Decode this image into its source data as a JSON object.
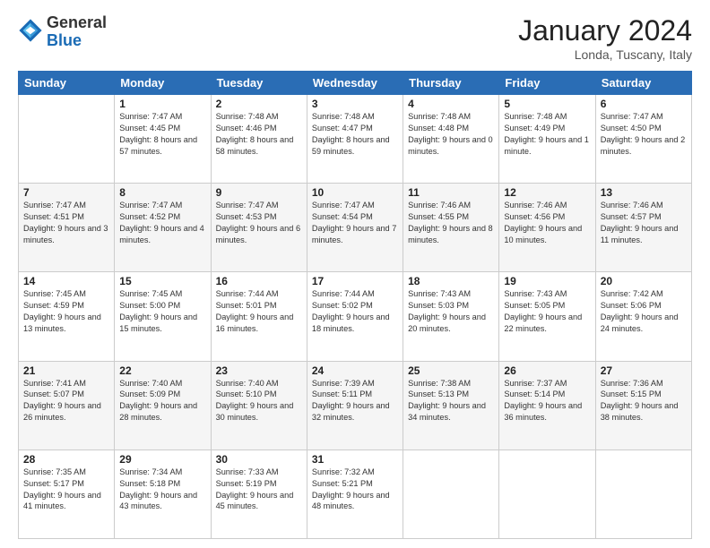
{
  "header": {
    "logo_general": "General",
    "logo_blue": "Blue",
    "month_title": "January 2024",
    "location": "Londa, Tuscany, Italy"
  },
  "days_of_week": [
    "Sunday",
    "Monday",
    "Tuesday",
    "Wednesday",
    "Thursday",
    "Friday",
    "Saturday"
  ],
  "weeks": [
    [
      {
        "day": "",
        "sunrise": "",
        "sunset": "",
        "daylight": ""
      },
      {
        "day": "1",
        "sunrise": "Sunrise: 7:47 AM",
        "sunset": "Sunset: 4:45 PM",
        "daylight": "Daylight: 8 hours and 57 minutes."
      },
      {
        "day": "2",
        "sunrise": "Sunrise: 7:48 AM",
        "sunset": "Sunset: 4:46 PM",
        "daylight": "Daylight: 8 hours and 58 minutes."
      },
      {
        "day": "3",
        "sunrise": "Sunrise: 7:48 AM",
        "sunset": "Sunset: 4:47 PM",
        "daylight": "Daylight: 8 hours and 59 minutes."
      },
      {
        "day": "4",
        "sunrise": "Sunrise: 7:48 AM",
        "sunset": "Sunset: 4:48 PM",
        "daylight": "Daylight: 9 hours and 0 minutes."
      },
      {
        "day": "5",
        "sunrise": "Sunrise: 7:48 AM",
        "sunset": "Sunset: 4:49 PM",
        "daylight": "Daylight: 9 hours and 1 minute."
      },
      {
        "day": "6",
        "sunrise": "Sunrise: 7:47 AM",
        "sunset": "Sunset: 4:50 PM",
        "daylight": "Daylight: 9 hours and 2 minutes."
      }
    ],
    [
      {
        "day": "7",
        "sunrise": "Sunrise: 7:47 AM",
        "sunset": "Sunset: 4:51 PM",
        "daylight": "Daylight: 9 hours and 3 minutes."
      },
      {
        "day": "8",
        "sunrise": "Sunrise: 7:47 AM",
        "sunset": "Sunset: 4:52 PM",
        "daylight": "Daylight: 9 hours and 4 minutes."
      },
      {
        "day": "9",
        "sunrise": "Sunrise: 7:47 AM",
        "sunset": "Sunset: 4:53 PM",
        "daylight": "Daylight: 9 hours and 6 minutes."
      },
      {
        "day": "10",
        "sunrise": "Sunrise: 7:47 AM",
        "sunset": "Sunset: 4:54 PM",
        "daylight": "Daylight: 9 hours and 7 minutes."
      },
      {
        "day": "11",
        "sunrise": "Sunrise: 7:46 AM",
        "sunset": "Sunset: 4:55 PM",
        "daylight": "Daylight: 9 hours and 8 minutes."
      },
      {
        "day": "12",
        "sunrise": "Sunrise: 7:46 AM",
        "sunset": "Sunset: 4:56 PM",
        "daylight": "Daylight: 9 hours and 10 minutes."
      },
      {
        "day": "13",
        "sunrise": "Sunrise: 7:46 AM",
        "sunset": "Sunset: 4:57 PM",
        "daylight": "Daylight: 9 hours and 11 minutes."
      }
    ],
    [
      {
        "day": "14",
        "sunrise": "Sunrise: 7:45 AM",
        "sunset": "Sunset: 4:59 PM",
        "daylight": "Daylight: 9 hours and 13 minutes."
      },
      {
        "day": "15",
        "sunrise": "Sunrise: 7:45 AM",
        "sunset": "Sunset: 5:00 PM",
        "daylight": "Daylight: 9 hours and 15 minutes."
      },
      {
        "day": "16",
        "sunrise": "Sunrise: 7:44 AM",
        "sunset": "Sunset: 5:01 PM",
        "daylight": "Daylight: 9 hours and 16 minutes."
      },
      {
        "day": "17",
        "sunrise": "Sunrise: 7:44 AM",
        "sunset": "Sunset: 5:02 PM",
        "daylight": "Daylight: 9 hours and 18 minutes."
      },
      {
        "day": "18",
        "sunrise": "Sunrise: 7:43 AM",
        "sunset": "Sunset: 5:03 PM",
        "daylight": "Daylight: 9 hours and 20 minutes."
      },
      {
        "day": "19",
        "sunrise": "Sunrise: 7:43 AM",
        "sunset": "Sunset: 5:05 PM",
        "daylight": "Daylight: 9 hours and 22 minutes."
      },
      {
        "day": "20",
        "sunrise": "Sunrise: 7:42 AM",
        "sunset": "Sunset: 5:06 PM",
        "daylight": "Daylight: 9 hours and 24 minutes."
      }
    ],
    [
      {
        "day": "21",
        "sunrise": "Sunrise: 7:41 AM",
        "sunset": "Sunset: 5:07 PM",
        "daylight": "Daylight: 9 hours and 26 minutes."
      },
      {
        "day": "22",
        "sunrise": "Sunrise: 7:40 AM",
        "sunset": "Sunset: 5:09 PM",
        "daylight": "Daylight: 9 hours and 28 minutes."
      },
      {
        "day": "23",
        "sunrise": "Sunrise: 7:40 AM",
        "sunset": "Sunset: 5:10 PM",
        "daylight": "Daylight: 9 hours and 30 minutes."
      },
      {
        "day": "24",
        "sunrise": "Sunrise: 7:39 AM",
        "sunset": "Sunset: 5:11 PM",
        "daylight": "Daylight: 9 hours and 32 minutes."
      },
      {
        "day": "25",
        "sunrise": "Sunrise: 7:38 AM",
        "sunset": "Sunset: 5:13 PM",
        "daylight": "Daylight: 9 hours and 34 minutes."
      },
      {
        "day": "26",
        "sunrise": "Sunrise: 7:37 AM",
        "sunset": "Sunset: 5:14 PM",
        "daylight": "Daylight: 9 hours and 36 minutes."
      },
      {
        "day": "27",
        "sunrise": "Sunrise: 7:36 AM",
        "sunset": "Sunset: 5:15 PM",
        "daylight": "Daylight: 9 hours and 38 minutes."
      }
    ],
    [
      {
        "day": "28",
        "sunrise": "Sunrise: 7:35 AM",
        "sunset": "Sunset: 5:17 PM",
        "daylight": "Daylight: 9 hours and 41 minutes."
      },
      {
        "day": "29",
        "sunrise": "Sunrise: 7:34 AM",
        "sunset": "Sunset: 5:18 PM",
        "daylight": "Daylight: 9 hours and 43 minutes."
      },
      {
        "day": "30",
        "sunrise": "Sunrise: 7:33 AM",
        "sunset": "Sunset: 5:19 PM",
        "daylight": "Daylight: 9 hours and 45 minutes."
      },
      {
        "day": "31",
        "sunrise": "Sunrise: 7:32 AM",
        "sunset": "Sunset: 5:21 PM",
        "daylight": "Daylight: 9 hours and 48 minutes."
      },
      {
        "day": "",
        "sunrise": "",
        "sunset": "",
        "daylight": ""
      },
      {
        "day": "",
        "sunrise": "",
        "sunset": "",
        "daylight": ""
      },
      {
        "day": "",
        "sunrise": "",
        "sunset": "",
        "daylight": ""
      }
    ]
  ]
}
